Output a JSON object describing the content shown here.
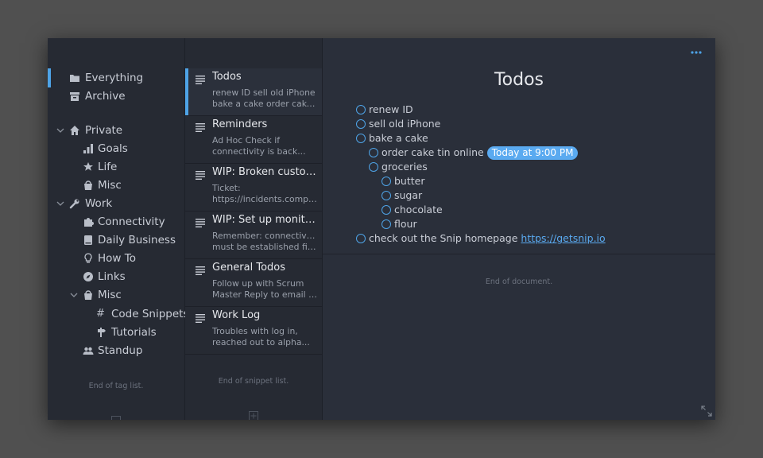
{
  "tags": {
    "everything": "Everything",
    "archive": "Archive",
    "private": "Private",
    "goals": "Goals",
    "life": "Life",
    "misc_private": "Misc",
    "work": "Work",
    "connectivity": "Connectivity",
    "daily_business": "Daily Business",
    "how_to": "How To",
    "links": "Links",
    "misc_work": "Misc",
    "code_snippets": "Code Snippets",
    "tutorials": "Tutorials",
    "standup": "Standup",
    "end_note": "End of tag list."
  },
  "snippets": {
    "items": [
      {
        "title": "Todos",
        "line1": "renew ID sell old iPhone",
        "line2": "bake a cake order cake ti..."
      },
      {
        "title": "Reminders",
        "line1": "Ad Hoc Check if",
        "line2": "connectivity is back..."
      },
      {
        "title": "WIP: Broken custom...",
        "line1": "Ticket:",
        "line2": "https://incidents.compan..."
      },
      {
        "title": "WIP: Set up monitori...",
        "line1": "Remember: connectivity",
        "line2": "must be established first ..."
      },
      {
        "title": "General Todos",
        "line1": "Follow up with Scrum",
        "line2": "Master Reply to email fro..."
      },
      {
        "title": "Work Log",
        "line1": "Troubles with log in,",
        "line2": "reached out to alpha..."
      }
    ],
    "end_note": "End of snippet list."
  },
  "document": {
    "title": "Todos",
    "todos": {
      "renew_id": "renew ID",
      "sell_iphone": "sell old iPhone",
      "bake_cake": "bake a cake",
      "order_tin": "order cake tin online",
      "reminder_badge": "Today at 9:00 PM",
      "groceries": "groceries",
      "butter": "butter",
      "sugar": "sugar",
      "chocolate": "chocolate",
      "flour": "flour",
      "check_out": "check out the Snip homepage",
      "link": "https://getsnip.io"
    },
    "end_note": "End of document."
  },
  "colors": {
    "accent": "#4ea3e6",
    "background": "#2a2f3a",
    "sidebar": "#262a33"
  }
}
